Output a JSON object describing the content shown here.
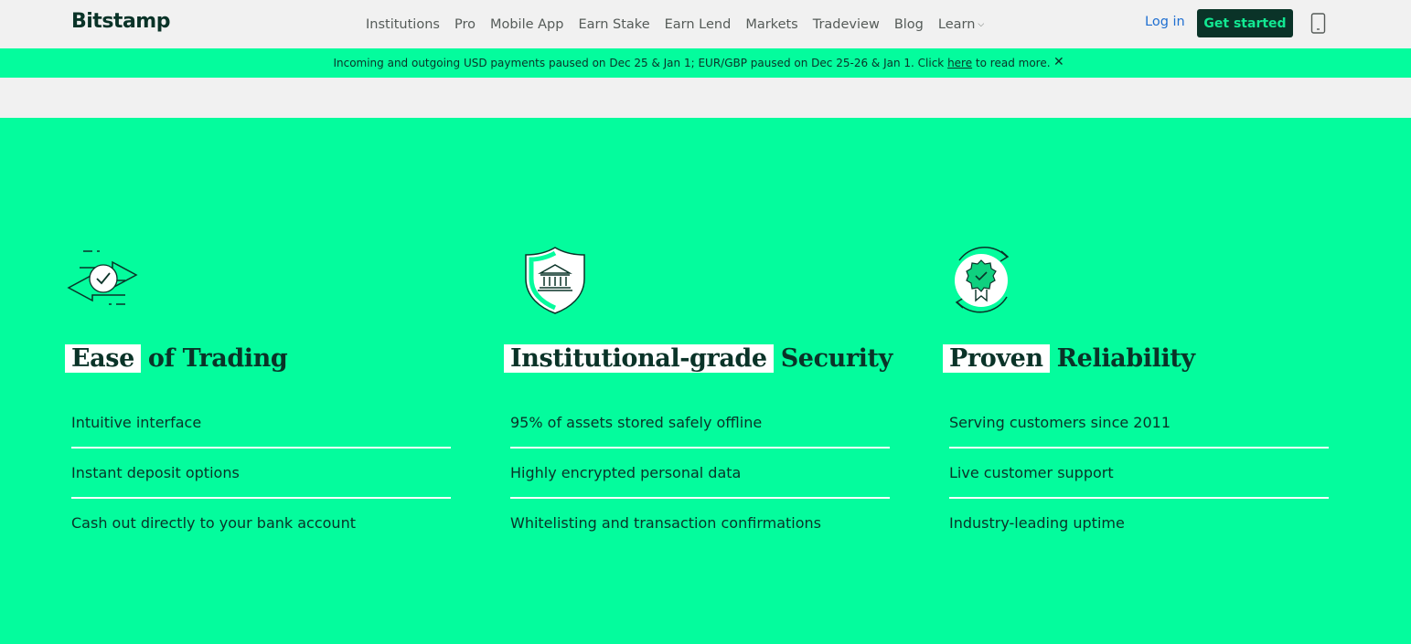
{
  "header": {
    "logo": "Bitstamp",
    "nav": [
      {
        "label": "Institutions"
      },
      {
        "label": "Pro"
      },
      {
        "label": "Mobile App"
      },
      {
        "label": "Earn Stake"
      },
      {
        "label": "Earn Lend"
      },
      {
        "label": "Markets"
      },
      {
        "label": "Tradeview"
      },
      {
        "label": "Blog"
      },
      {
        "label": "Learn"
      }
    ],
    "login": "Log in",
    "get_started": "Get started",
    "phone_icon": "mobile-phone-icon"
  },
  "banner": {
    "text_before": "Incoming and outgoing USD payments paused on Dec 25 & Jan 1; EUR/GBP paused on Dec 25-26 & Jan 1. Click ",
    "link": "here",
    "text_after": " to read more.",
    "close": "✕"
  },
  "features": [
    {
      "icon": "transfer-arrows-check-icon",
      "title_highlight": "Ease",
      "title_rest": "of Trading",
      "items": [
        "Intuitive interface",
        "Instant deposit options",
        "Cash out directly to your bank account"
      ]
    },
    {
      "icon": "shield-bank-icon",
      "title_highlight": "Institutional-grade",
      "title_rest": "Security",
      "items": [
        "95% of assets stored safely offline",
        "Highly encrypted personal data",
        "Whitelisting and transaction confirmations"
      ]
    },
    {
      "icon": "award-badge-cycle-icon",
      "title_highlight": "Proven",
      "title_rest": "Reliability",
      "items": [
        "Serving customers since 2011",
        "Live customer support",
        "Industry-leading uptime"
      ]
    }
  ],
  "colors": {
    "brand_dark": "#0a3328",
    "brand_green": "#04fc9d",
    "link_blue": "#1f6fd1",
    "background": "#f1f1f1"
  }
}
